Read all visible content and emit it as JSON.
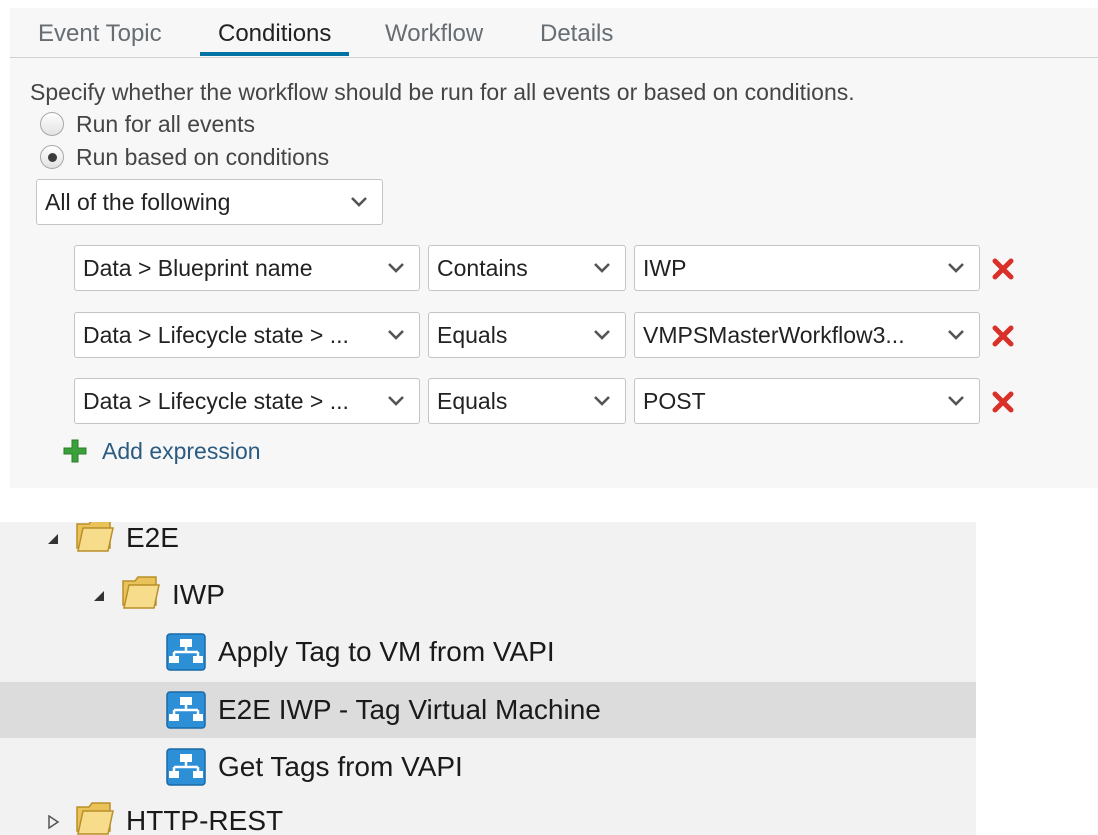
{
  "tabs": [
    "Event Topic",
    "Conditions",
    "Workflow",
    "Details"
  ],
  "active_tab": "Conditions",
  "intro": "Specify whether the workflow should be run for all events or based on conditions.",
  "radios": {
    "all_events": "Run for all events",
    "based_on_conditions": "Run based on conditions",
    "selected": "based_on_conditions"
  },
  "match_mode": "All of the following",
  "conditions": [
    {
      "field": "Data > Blueprint name",
      "operator": "Contains",
      "value": "IWP"
    },
    {
      "field": "Data > Lifecycle state > ...",
      "operator": "Equals",
      "value": "VMPSMasterWorkflow3..."
    },
    {
      "field": "Data > Lifecycle state > ...",
      "operator": "Equals",
      "value": "POST"
    }
  ],
  "add_expression": "Add expression",
  "tree": {
    "e2e": "E2E",
    "iwp": "IWP",
    "items": [
      "Apply Tag to VM from VAPI",
      "E2E IWP - Tag Virtual Machine",
      "Get Tags from VAPI"
    ],
    "selected_item": "E2E IWP - Tag Virtual Machine",
    "http_rest": "HTTP-REST"
  },
  "colors": {
    "accent": "#0072a3",
    "link": "#2c5b81",
    "remove": "#d9312a",
    "add": "#3aa13a",
    "selected_row": "#dcdcdc"
  }
}
